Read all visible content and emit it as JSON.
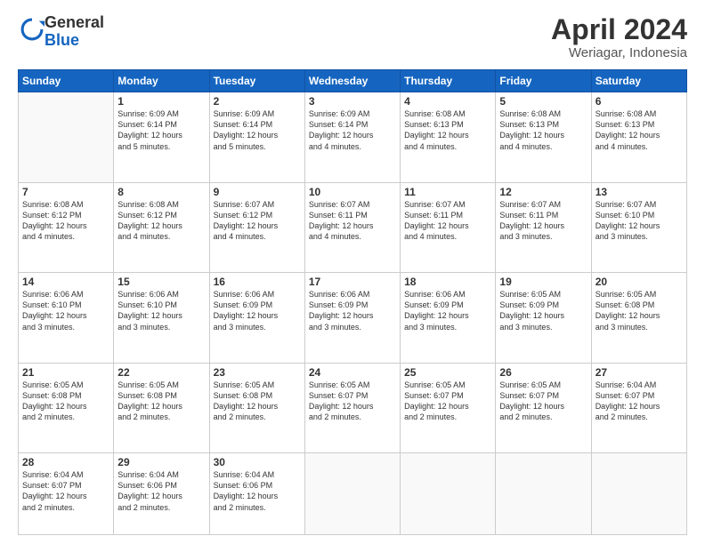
{
  "logo": {
    "general": "General",
    "blue": "Blue"
  },
  "header": {
    "month": "April 2024",
    "location": "Weriagar, Indonesia"
  },
  "weekdays": [
    "Sunday",
    "Monday",
    "Tuesday",
    "Wednesday",
    "Thursday",
    "Friday",
    "Saturday"
  ],
  "weeks": [
    [
      {
        "day": "",
        "info": ""
      },
      {
        "day": "1",
        "info": "Sunrise: 6:09 AM\nSunset: 6:14 PM\nDaylight: 12 hours\nand 5 minutes."
      },
      {
        "day": "2",
        "info": "Sunrise: 6:09 AM\nSunset: 6:14 PM\nDaylight: 12 hours\nand 5 minutes."
      },
      {
        "day": "3",
        "info": "Sunrise: 6:09 AM\nSunset: 6:14 PM\nDaylight: 12 hours\nand 4 minutes."
      },
      {
        "day": "4",
        "info": "Sunrise: 6:08 AM\nSunset: 6:13 PM\nDaylight: 12 hours\nand 4 minutes."
      },
      {
        "day": "5",
        "info": "Sunrise: 6:08 AM\nSunset: 6:13 PM\nDaylight: 12 hours\nand 4 minutes."
      },
      {
        "day": "6",
        "info": "Sunrise: 6:08 AM\nSunset: 6:13 PM\nDaylight: 12 hours\nand 4 minutes."
      }
    ],
    [
      {
        "day": "7",
        "info": "Sunrise: 6:08 AM\nSunset: 6:12 PM\nDaylight: 12 hours\nand 4 minutes."
      },
      {
        "day": "8",
        "info": "Sunrise: 6:08 AM\nSunset: 6:12 PM\nDaylight: 12 hours\nand 4 minutes."
      },
      {
        "day": "9",
        "info": "Sunrise: 6:07 AM\nSunset: 6:12 PM\nDaylight: 12 hours\nand 4 minutes."
      },
      {
        "day": "10",
        "info": "Sunrise: 6:07 AM\nSunset: 6:11 PM\nDaylight: 12 hours\nand 4 minutes."
      },
      {
        "day": "11",
        "info": "Sunrise: 6:07 AM\nSunset: 6:11 PM\nDaylight: 12 hours\nand 4 minutes."
      },
      {
        "day": "12",
        "info": "Sunrise: 6:07 AM\nSunset: 6:11 PM\nDaylight: 12 hours\nand 3 minutes."
      },
      {
        "day": "13",
        "info": "Sunrise: 6:07 AM\nSunset: 6:10 PM\nDaylight: 12 hours\nand 3 minutes."
      }
    ],
    [
      {
        "day": "14",
        "info": "Sunrise: 6:06 AM\nSunset: 6:10 PM\nDaylight: 12 hours\nand 3 minutes."
      },
      {
        "day": "15",
        "info": "Sunrise: 6:06 AM\nSunset: 6:10 PM\nDaylight: 12 hours\nand 3 minutes."
      },
      {
        "day": "16",
        "info": "Sunrise: 6:06 AM\nSunset: 6:09 PM\nDaylight: 12 hours\nand 3 minutes."
      },
      {
        "day": "17",
        "info": "Sunrise: 6:06 AM\nSunset: 6:09 PM\nDaylight: 12 hours\nand 3 minutes."
      },
      {
        "day": "18",
        "info": "Sunrise: 6:06 AM\nSunset: 6:09 PM\nDaylight: 12 hours\nand 3 minutes."
      },
      {
        "day": "19",
        "info": "Sunrise: 6:05 AM\nSunset: 6:09 PM\nDaylight: 12 hours\nand 3 minutes."
      },
      {
        "day": "20",
        "info": "Sunrise: 6:05 AM\nSunset: 6:08 PM\nDaylight: 12 hours\nand 3 minutes."
      }
    ],
    [
      {
        "day": "21",
        "info": "Sunrise: 6:05 AM\nSunset: 6:08 PM\nDaylight: 12 hours\nand 2 minutes."
      },
      {
        "day": "22",
        "info": "Sunrise: 6:05 AM\nSunset: 6:08 PM\nDaylight: 12 hours\nand 2 minutes."
      },
      {
        "day": "23",
        "info": "Sunrise: 6:05 AM\nSunset: 6:08 PM\nDaylight: 12 hours\nand 2 minutes."
      },
      {
        "day": "24",
        "info": "Sunrise: 6:05 AM\nSunset: 6:07 PM\nDaylight: 12 hours\nand 2 minutes."
      },
      {
        "day": "25",
        "info": "Sunrise: 6:05 AM\nSunset: 6:07 PM\nDaylight: 12 hours\nand 2 minutes."
      },
      {
        "day": "26",
        "info": "Sunrise: 6:05 AM\nSunset: 6:07 PM\nDaylight: 12 hours\nand 2 minutes."
      },
      {
        "day": "27",
        "info": "Sunrise: 6:04 AM\nSunset: 6:07 PM\nDaylight: 12 hours\nand 2 minutes."
      }
    ],
    [
      {
        "day": "28",
        "info": "Sunrise: 6:04 AM\nSunset: 6:07 PM\nDaylight: 12 hours\nand 2 minutes."
      },
      {
        "day": "29",
        "info": "Sunrise: 6:04 AM\nSunset: 6:06 PM\nDaylight: 12 hours\nand 2 minutes."
      },
      {
        "day": "30",
        "info": "Sunrise: 6:04 AM\nSunset: 6:06 PM\nDaylight: 12 hours\nand 2 minutes."
      },
      {
        "day": "",
        "info": ""
      },
      {
        "day": "",
        "info": ""
      },
      {
        "day": "",
        "info": ""
      },
      {
        "day": "",
        "info": ""
      }
    ]
  ]
}
